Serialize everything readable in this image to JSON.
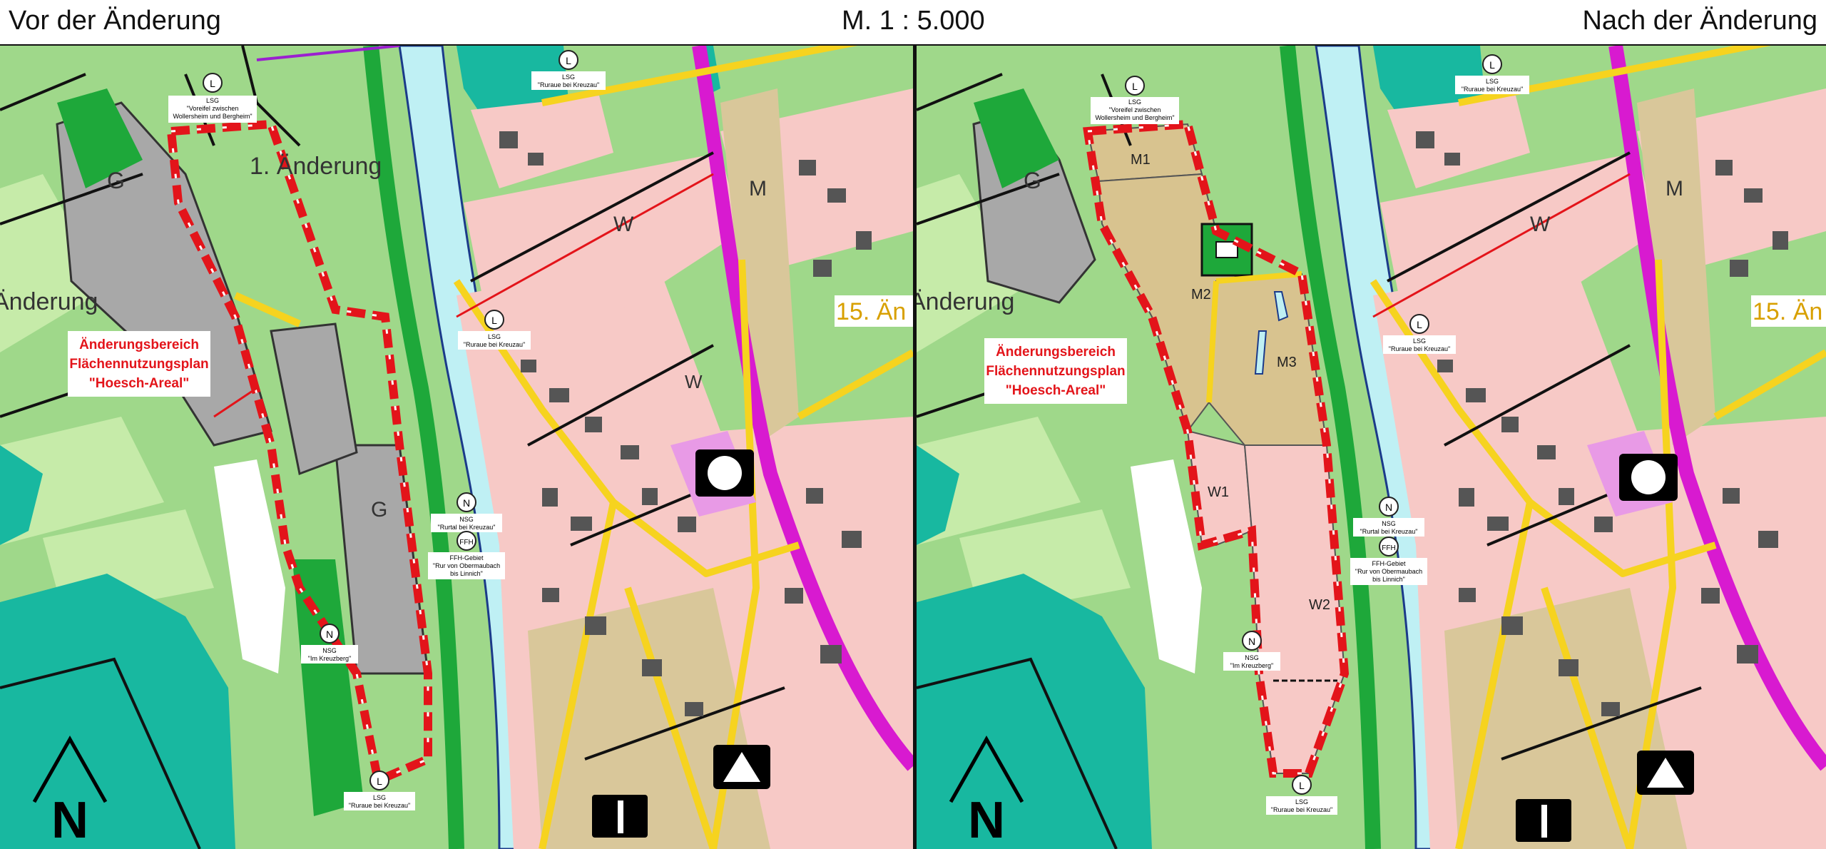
{
  "header": {
    "left_title": "Vor der Änderung",
    "scale": "M. 1 : 5.000",
    "right_title": "Nach der Änderung"
  },
  "colors": {
    "agriculture": "#9fd88a",
    "agriculture_light": "#c6eba9",
    "forest": "#18b8a0",
    "green_space": "#1ea83a",
    "river": "#bff0f4",
    "commercial": "#a8a8a8",
    "residential": "#f7c9c6",
    "mixed": "#d9c79a",
    "road_main": "#f6d31f",
    "railway": "#d81ad0",
    "change_area": "#e3141a"
  },
  "left": {
    "change_area_label": [
      "Änderungsbereich",
      "Flächennutzungsplan",
      "\"Hoesch-Areal\""
    ],
    "partial_labels": {
      "aenderung_1": "1. Änderung",
      "aenderung_edge": "Änderung",
      "aenderung_15": "15. Än"
    },
    "zones": {
      "G_top": "G",
      "G_bottom": "G",
      "W": "W",
      "M_top": "M",
      "W_small": "W"
    },
    "markers": {
      "lsg_wollersheim": {
        "symbol": "L",
        "lines": [
          "LSG",
          "\"Voreifel zwischen",
          "Wollersheim und Bergheim\""
        ]
      },
      "lsg_ruraue_top": {
        "symbol": "L",
        "lines": [
          "LSG",
          "\"Ruraue bei Kreuzau\""
        ]
      },
      "lsg_ruraue_mid": {
        "symbol": "L",
        "lines": [
          "LSG",
          "\"Ruraue bei Kreuzau\""
        ]
      },
      "nsg_rurtal": {
        "symbol": "N",
        "lines": [
          "NSG",
          "\"Rurtal bei Kreuzau\""
        ]
      },
      "ffh": {
        "symbol": "FFH",
        "lines": [
          "FFH-Gebiet",
          "\"Rur von Obermaubach",
          "bis Linnich\""
        ]
      },
      "nsg_kreuzberg": {
        "symbol": "N",
        "lines": [
          "NSG",
          "\"Im Kreuzberg\""
        ]
      },
      "lsg_ruraue_bottom": {
        "symbol": "L",
        "lines": [
          "LSG",
          "\"Ruraue bei Kreuzau\""
        ]
      }
    },
    "north_label": "N"
  },
  "right": {
    "change_area_label": [
      "Änderungsbereich",
      "Flächennutzungsplan",
      "\"Hoesch-Areal\""
    ],
    "partial_labels": {
      "aenderung_edge": "Änderung",
      "aenderung_15": "15. Än"
    },
    "zones": {
      "M1": "M1",
      "M2": "M2",
      "M3": "M3",
      "W1": "W1",
      "W2": "W2",
      "W": "W",
      "M_top": "M",
      "G_top": "G"
    },
    "markers": {
      "lsg_wollersheim": {
        "symbol": "L",
        "lines": [
          "LSG",
          "\"Voreifel zwischen",
          "Wollersheim und Bergheim\""
        ]
      },
      "lsg_ruraue_top": {
        "symbol": "L",
        "lines": [
          "LSG",
          "\"Ruraue bei Kreuzau\""
        ]
      },
      "lsg_ruraue_mid": {
        "symbol": "L",
        "lines": [
          "LSG",
          "\"Ruraue bei Kreuzau\""
        ]
      },
      "nsg_rurtal": {
        "symbol": "N",
        "lines": [
          "NSG",
          "\"Rurtal bei Kreuzau\""
        ]
      },
      "ffh": {
        "symbol": "FFH",
        "lines": [
          "FFH-Gebiet",
          "\"Rur von Obermaubach",
          "bis Linnich\""
        ]
      },
      "nsg_kreuzberg": {
        "symbol": "N",
        "lines": [
          "NSG",
          "\"Im Kreuzberg\""
        ]
      },
      "lsg_ruraue_bottom": {
        "symbol": "L",
        "lines": [
          "LSG",
          "\"Ruraue bei Kreuzau\""
        ]
      }
    },
    "north_label": "N"
  }
}
